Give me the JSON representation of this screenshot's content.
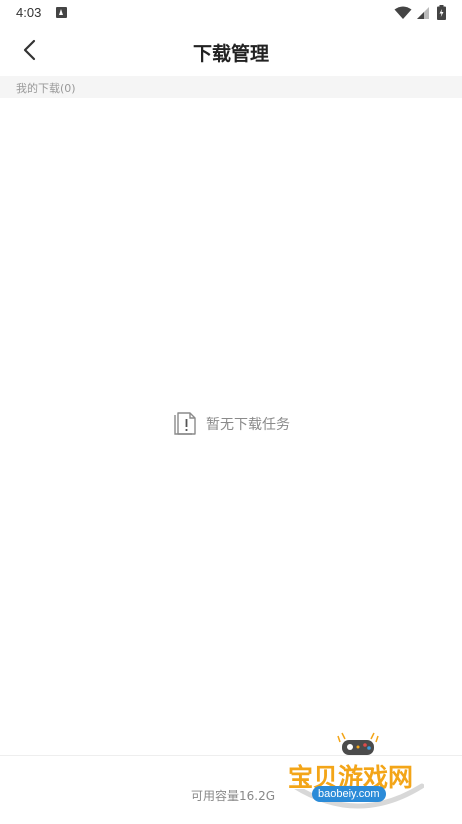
{
  "status_bar": {
    "time": "4:03",
    "icons": [
      "a-notification-icon",
      "wifi-icon",
      "signal-icon",
      "battery-icon"
    ]
  },
  "header": {
    "title": "下载管理",
    "back_icon": "chevron-left-icon"
  },
  "section": {
    "label": "我的下载(0)"
  },
  "empty_state": {
    "icon": "empty-document-icon",
    "text": "暂无下载任务"
  },
  "footer": {
    "capacity": "可用容量16.2G"
  },
  "watermark": {
    "title": "宝贝游戏网",
    "domain": "baobeiy.com",
    "icon": "gamepad-icon"
  },
  "colors": {
    "section_bg": "#f5f5f5",
    "muted_text": "#999999",
    "watermark_orange": "#f3a518",
    "watermark_blue": "#2b8bd8"
  }
}
